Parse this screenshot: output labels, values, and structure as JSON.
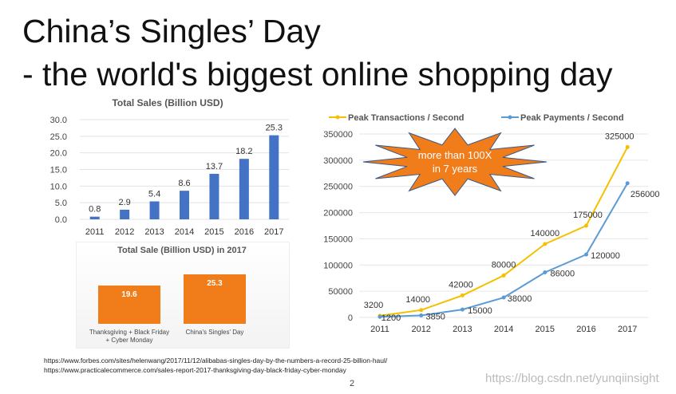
{
  "title_line1": "China’s Singles’ Day",
  "title_line2": "- the world's biggest online shopping day",
  "chart_data": [
    {
      "type": "bar",
      "title": "Total Sales (Billion USD)",
      "categories": [
        "2011",
        "2012",
        "2013",
        "2014",
        "2015",
        "2016",
        "2017"
      ],
      "values": [
        0.8,
        2.9,
        5.4,
        8.6,
        13.7,
        18.2,
        25.3
      ],
      "data_labels": [
        "0.8",
        "2.9",
        "5.4",
        "8.6",
        "13.7",
        "18.2",
        "25.3"
      ],
      "yticks": [
        "0.0",
        "5.0",
        "10.0",
        "15.0",
        "20.0",
        "25.0",
        "30.0"
      ],
      "ylim": [
        0,
        30
      ],
      "color": "#4472c4"
    },
    {
      "type": "bar",
      "title": "Total Sale (Billion USD) in 2017",
      "categories": [
        "Thanksgiving + Black Friday",
        "China's Singles' Day"
      ],
      "category_line2": [
        "+ Cyber Monday",
        ""
      ],
      "values": [
        19.6,
        25.3
      ],
      "data_labels": [
        "19.6",
        "25.3"
      ],
      "color": "#f07c1a"
    },
    {
      "type": "line",
      "categories": [
        "2011",
        "2012",
        "2013",
        "2014",
        "2015",
        "2016",
        "2017"
      ],
      "yticks": [
        "0",
        "50000",
        "100000",
        "150000",
        "200000",
        "250000",
        "300000",
        "350000"
      ],
      "ylim": [
        0,
        350000
      ],
      "series": [
        {
          "name": "Peak Transactions / Second",
          "color": "#f5c000",
          "values": [
            3200,
            14000,
            42000,
            80000,
            140000,
            175000,
            325000
          ],
          "labels": [
            "3200",
            "14000",
            "42000",
            "80000",
            "140000",
            "175000",
            "325000"
          ]
        },
        {
          "name": "Peak Payments / Second",
          "color": "#5b9bd5",
          "values": [
            1200,
            3850,
            15000,
            38000,
            86000,
            120000,
            256000
          ],
          "labels": [
            "1200",
            "3850",
            "15000",
            "38000",
            "86000",
            "120000",
            "256000"
          ]
        }
      ],
      "annotation_line1": "more than 100X",
      "annotation_line2": "in 7 years"
    }
  ],
  "sources": [
    "https://www.forbes.com/sites/helenwang/2017/11/12/alibabas-singles-day-by-the-numbers-a-record-25-billion-haul/",
    "https://www.practicalecommerce.com/sales-report-2017-thanksgiving-day-black-friday-cyber-monday"
  ],
  "page_number": "2",
  "watermark": "https://blog.csdn.net/yunqiinsight"
}
